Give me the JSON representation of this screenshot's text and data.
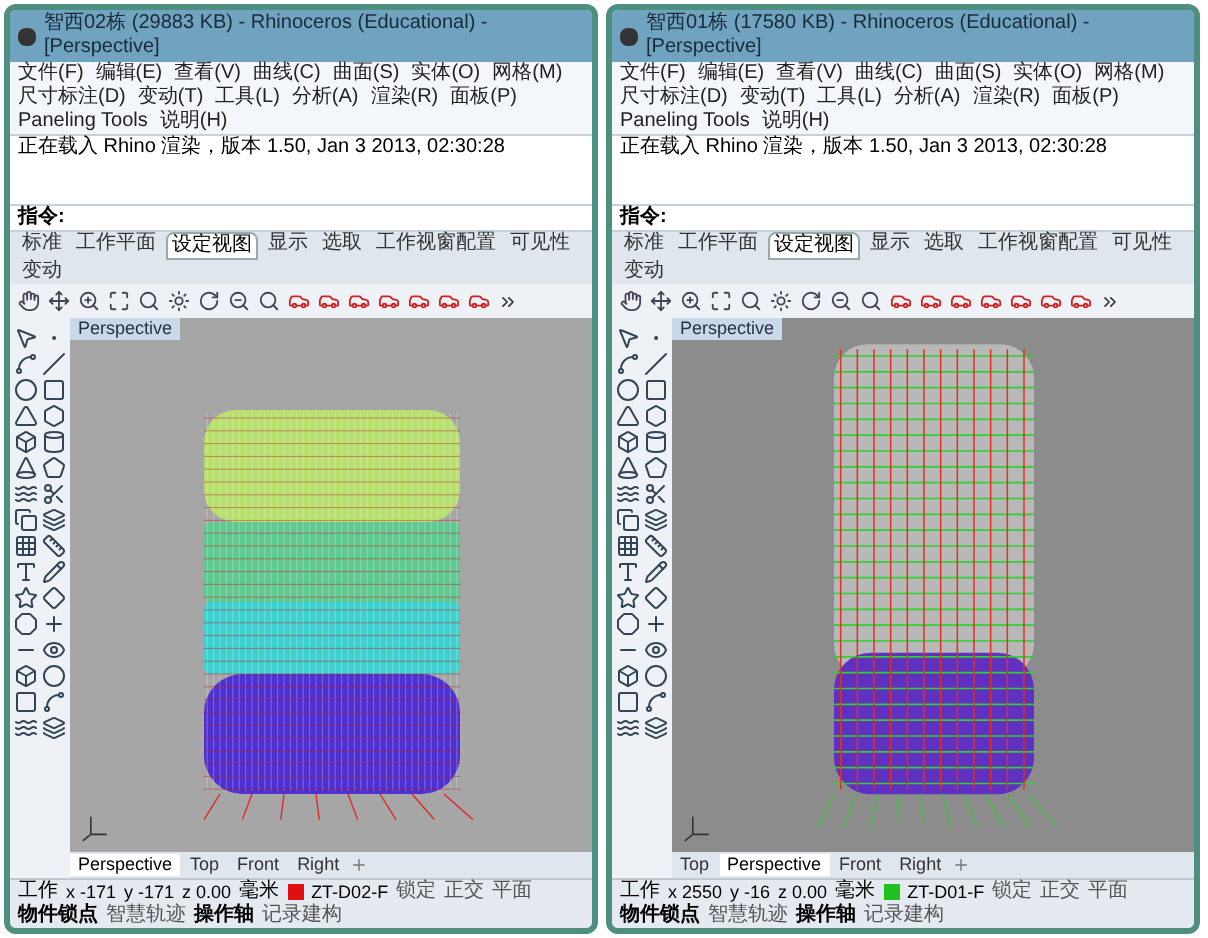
{
  "windows": [
    {
      "title": "智西02栋 (29883 KB) - Rhinoceros (Educational) - [Perspective]",
      "menus": [
        "文件(F)",
        "编辑(E)",
        "查看(V)",
        "曲线(C)",
        "曲面(S)",
        "实体(O)",
        "网格(M)",
        "尺寸标注(D)",
        "变动(T)",
        "工具(L)",
        "分析(A)",
        "渲染(R)",
        "面板(P)",
        "Paneling Tools",
        "说明(H)"
      ],
      "command_history": "正在载入 Rhino 渲染，版本 1.50, Jan  3 2013, 02:30:28",
      "command_prompt": "指令:",
      "toolbar_tabs": [
        {
          "label": "标准",
          "selected": false
        },
        {
          "label": "工作平面",
          "selected": false
        },
        {
          "label": "设定视图",
          "selected": true
        },
        {
          "label": "显示",
          "selected": false
        },
        {
          "label": "选取",
          "selected": false
        },
        {
          "label": "工作视窗配置",
          "selected": false
        },
        {
          "label": "可见性",
          "selected": false
        },
        {
          "label": "变动",
          "selected": false
        }
      ],
      "viewport_label": "Perspective",
      "kind": "wide",
      "viewport_tabs": [
        {
          "label": "Perspective",
          "selected": true
        },
        {
          "label": "Top",
          "selected": false
        },
        {
          "label": "Front",
          "selected": false
        },
        {
          "label": "Right",
          "selected": false
        }
      ],
      "status": {
        "plane": "工作",
        "coords": [
          "x -171",
          "y -171",
          "z 0.00"
        ],
        "unit": "毫米",
        "layer": {
          "name": "ZT-D02-F",
          "color": "#e01010"
        },
        "toggles": [
          {
            "label": "锁定",
            "on": false
          },
          {
            "label": "正交",
            "on": false
          },
          {
            "label": "平面",
            "on": false
          },
          {
            "label": "物件锁点",
            "on": true
          },
          {
            "label": "智慧轨迹",
            "on": false
          },
          {
            "label": "操作轴",
            "on": true
          },
          {
            "label": "记录建构",
            "on": false
          }
        ]
      }
    },
    {
      "title": "智西01栋 (17580 KB) - Rhinoceros (Educational) - [Perspective]",
      "menus": [
        "文件(F)",
        "编辑(E)",
        "查看(V)",
        "曲线(C)",
        "曲面(S)",
        "实体(O)",
        "网格(M)",
        "尺寸标注(D)",
        "变动(T)",
        "工具(L)",
        "分析(A)",
        "渲染(R)",
        "面板(P)",
        "Paneling Tools",
        "说明(H)"
      ],
      "command_history": "正在载入 Rhino 渲染，版本 1.50, Jan  3 2013, 02:30:28",
      "command_prompt": "指令:",
      "toolbar_tabs": [
        {
          "label": "标准",
          "selected": false
        },
        {
          "label": "工作平面",
          "selected": false
        },
        {
          "label": "设定视图",
          "selected": true
        },
        {
          "label": "显示",
          "selected": false
        },
        {
          "label": "选取",
          "selected": false
        },
        {
          "label": "工作视窗配置",
          "selected": false
        },
        {
          "label": "可见性",
          "selected": false
        },
        {
          "label": "变动",
          "selected": false
        }
      ],
      "viewport_label": "Perspective",
      "kind": "tall",
      "viewport_tabs": [
        {
          "label": "Top",
          "selected": false
        },
        {
          "label": "Perspective",
          "selected": true
        },
        {
          "label": "Front",
          "selected": false
        },
        {
          "label": "Right",
          "selected": false
        }
      ],
      "status": {
        "plane": "工作",
        "coords": [
          "x 2550",
          "y -16",
          "z 0.00"
        ],
        "unit": "毫米",
        "layer": {
          "name": "ZT-D01-F",
          "color": "#20c020"
        },
        "toggles": [
          {
            "label": "锁定",
            "on": false
          },
          {
            "label": "正交",
            "on": false
          },
          {
            "label": "平面",
            "on": false
          },
          {
            "label": "物件锁点",
            "on": true
          },
          {
            "label": "智慧轨迹",
            "on": false
          },
          {
            "label": "操作轴",
            "on": true
          },
          {
            "label": "记录建构",
            "on": false
          }
        ]
      }
    }
  ]
}
